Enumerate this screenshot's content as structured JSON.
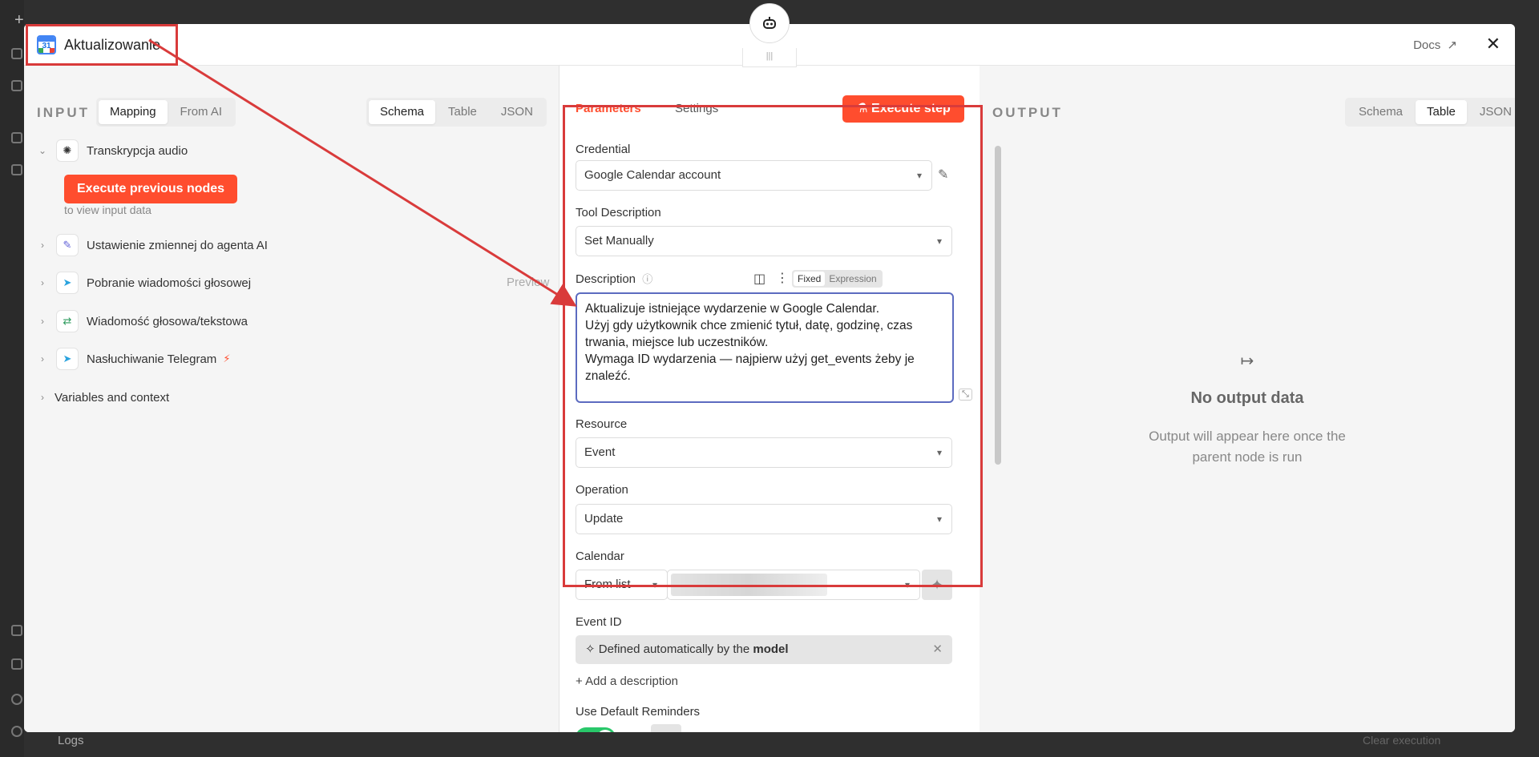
{
  "background": {
    "logs_label": "Logs",
    "clear_label": "Clear execution"
  },
  "header": {
    "node_title": "Aktualizowanie",
    "calendar_icon_number": "31",
    "docs_label": "Docs",
    "close_glyph": "✕"
  },
  "input_panel": {
    "label": "INPUT",
    "mode_tabs": [
      "Mapping",
      "From AI"
    ],
    "mode_active": "Mapping",
    "view_tabs": [
      "Schema",
      "Table",
      "JSON"
    ],
    "view_active": "Schema",
    "nodes": [
      {
        "name": "Transkrypcja audio",
        "icon": "openai-icon",
        "expanded": true
      },
      {
        "name": "Ustawienie zmiennej do agenta AI",
        "icon": "edit-set-icon"
      },
      {
        "name": "Pobranie wiadomości głosowej",
        "icon": "telegram-icon",
        "preview": "Preview"
      },
      {
        "name": "Wiadomość głosowa/tekstowa",
        "icon": "switch-icon"
      },
      {
        "name": "Nasłuchiwanie Telegram",
        "icon": "telegram-icon",
        "trigger": true
      }
    ],
    "execute_previous": "Execute previous nodes",
    "to_view": "to view input data",
    "variables": "Variables and context"
  },
  "params_panel": {
    "tabs": [
      "Parameters",
      "Settings"
    ],
    "active_tab": "Parameters",
    "execute_step": "Execute step",
    "credential_label": "Credential",
    "credential_value": "Google Calendar account",
    "tool_desc_label": "Tool Description",
    "tool_desc_value": "Set Manually",
    "description_label": "Description",
    "description_modes": [
      "Fixed",
      "Expression"
    ],
    "description_mode_active": "Fixed",
    "description_text": "Aktualizuje istniejące wydarzenie w Google Calendar.\nUżyj gdy użytkownik chce zmienić tytuł, datę, godzinę, czas trwania, miejsce lub uczestników.\nWymaga ID wydarzenia — najpierw użyj get_events żeby je znaleźć.",
    "resource_label": "Resource",
    "resource_value": "Event",
    "operation_label": "Operation",
    "operation_value": "Update",
    "calendar_label": "Calendar",
    "calendar_mode": "From list",
    "event_id_label": "Event ID",
    "event_id_prefix": "Defined automatically by the",
    "event_id_bold": "model",
    "add_description": "+ Add a description",
    "reminders_label": "Use Default Reminders",
    "reminders_enabled": true
  },
  "output_panel": {
    "label": "OUTPUT",
    "view_tabs": [
      "Schema",
      "Table",
      "JSON"
    ],
    "view_active": "Table",
    "empty_title": "No output data",
    "empty_line1": "Output will appear here once the",
    "empty_line2": "parent node is run"
  },
  "colors": {
    "accent": "#ff4d2e",
    "annotation": "#d93b3b",
    "toggle_on": "#29c86a",
    "focus_border": "#5c6bc0"
  }
}
